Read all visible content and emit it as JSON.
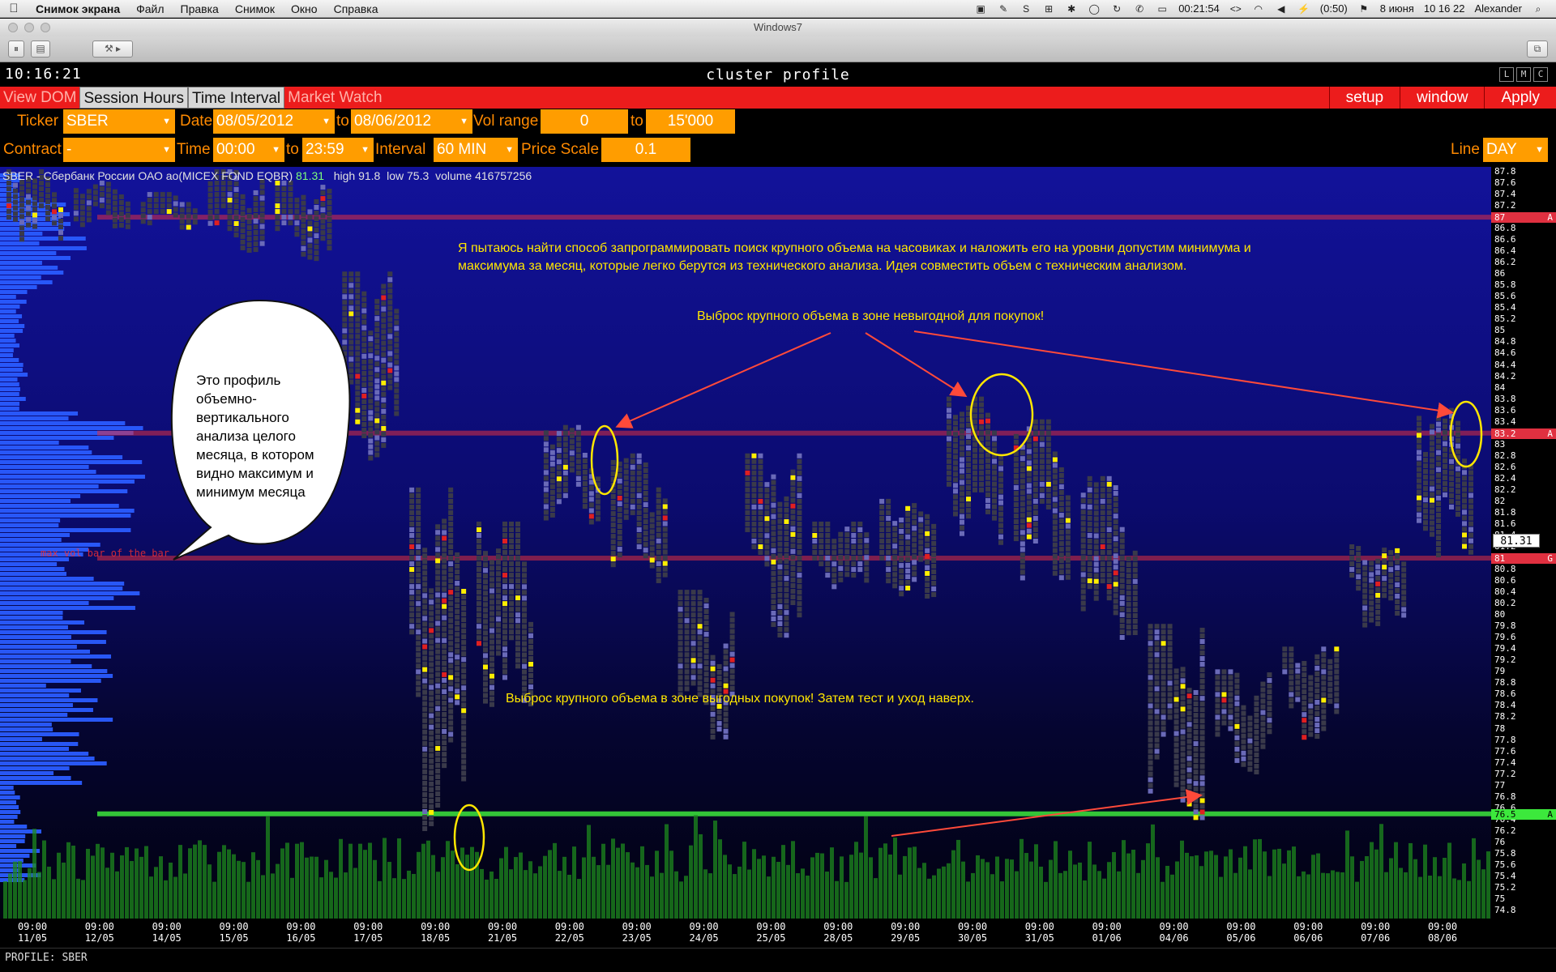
{
  "menubar": {
    "app_name": "Снимок экрана",
    "items": [
      "Файл",
      "Правка",
      "Снимок",
      "Окно",
      "Справка"
    ],
    "battery": "00:21:54",
    "battery_time": "(0:50)",
    "date": "8 июня",
    "time": "10 16 22",
    "user": "Alexander"
  },
  "window": {
    "title": "Windows7"
  },
  "app": {
    "clock": "10:16:21",
    "title": "cluster profile",
    "window_buttons": [
      "L",
      "M",
      "C"
    ]
  },
  "tabs": {
    "items": [
      "View DOM",
      "Session Hours",
      "Time Interval",
      "Market Watch"
    ],
    "right_buttons": [
      "setup",
      "window",
      "Apply"
    ]
  },
  "controls": {
    "ticker_label": "Ticker",
    "ticker_value": "SBER",
    "date_label": "Date",
    "date_from": "08/05/2012",
    "date_to_label": "to",
    "date_to": "08/06/2012",
    "vol_range_label": "Vol range",
    "vol_from": "0",
    "vol_to_label": "to",
    "vol_to": "15'000",
    "contract_label": "Contract",
    "contract_value": "-",
    "time_label": "Time",
    "time_from": "00:00",
    "time_to_label": "to",
    "time_to": "23:59",
    "interval_label": "Interval",
    "interval_value": "60 MIN",
    "price_scale_label": "Price Scale",
    "price_scale_value": "0.1",
    "line_label": "Line",
    "line_value": "DAY"
  },
  "chart_header": {
    "symbol": "SBER",
    "description": " - Сбербанк России ОАО ао(MICEX FOND EQBR) ",
    "last": "81.31",
    "high": "high 91.8",
    "low": "low 75.3",
    "volume": "volume 416757256"
  },
  "annotations": {
    "top_text_line1": "Я пытаюсь найти способ запрограммировать поиск крупного объема на часовиках и наложить его на уровни допустим минимума и",
    "top_text_line2": "максимума за месяц, которые легко берутся из технического анализа. Идея совместить объем с техническим анализом.",
    "unfavorable": "Выброс крупного объема в зоне невыгодной для покупок!",
    "favorable": "Выброс крупного объема в зоне выгодных покупок! Затем тест и уход наверх.",
    "bubble": "Это профиль объемно-вертикального анализа целого месяца, в котором видно максимум и минимум месяца",
    "max_vol_bar": "max vol bar of the bar"
  },
  "colors": {
    "accent_red": "#ec1c1c",
    "field_orange": "#ff9d00",
    "label_orange": "#ff8a00",
    "level_red": "#e03040",
    "level_green": "#3ce83c",
    "annotation_yellow": "#ffe600",
    "profile_blue": "#2a5cff"
  },
  "chart_data": {
    "type": "bar",
    "title": "cluster profile",
    "symbol": "SBER",
    "interval": "60 MIN",
    "price_range": [
      74.8,
      87.8
    ],
    "price_ticks": [
      "87.8",
      "87.6",
      "87.4",
      "87.2",
      "87",
      "86.8",
      "86.6",
      "86.4",
      "86.2",
      "86",
      "85.8",
      "85.6",
      "85.4",
      "85.2",
      "85",
      "84.8",
      "84.6",
      "84.4",
      "84.2",
      "84",
      "83.8",
      "83.6",
      "83.4",
      "83.2",
      "83",
      "82.8",
      "82.6",
      "82.4",
      "82.2",
      "82",
      "81.8",
      "81.6",
      "81.4",
      "81.2",
      "81",
      "80.8",
      "80.6",
      "80.4",
      "80.2",
      "80",
      "79.8",
      "79.6",
      "79.4",
      "79.2",
      "79",
      "78.8",
      "78.6",
      "78.4",
      "78.2",
      "78",
      "77.8",
      "77.6",
      "77.4",
      "77.2",
      "77",
      "76.8",
      "76.6",
      "76.4",
      "76.2",
      "76",
      "75.8",
      "75.6",
      "75.4",
      "75.2",
      "75",
      "74.8"
    ],
    "levels": [
      {
        "price": 87.0,
        "label": "87",
        "color": "#e03040",
        "marker": "A"
      },
      {
        "price": 83.2,
        "label": "83.2",
        "color": "#e03040",
        "marker": "A"
      },
      {
        "price": 81.0,
        "label": "81",
        "color": "#e03040",
        "marker": "G"
      },
      {
        "price": 76.5,
        "label": "76.5",
        "color": "#3ce83c",
        "marker": "A"
      }
    ],
    "current_price": "81.31",
    "categories": [
      "11/05",
      "12/05",
      "14/05",
      "15/05",
      "16/05",
      "17/05",
      "18/05",
      "21/05",
      "22/05",
      "23/05",
      "24/05",
      "25/05",
      "28/05",
      "29/05",
      "30/05",
      "31/05",
      "01/06",
      "04/06",
      "05/06",
      "06/06",
      "07/06",
      "08/06"
    ],
    "session_time": "09:00",
    "daily_high": [
      87.8,
      87.6,
      87.4,
      87.8,
      87.6,
      86.0,
      82.2,
      81.6,
      83.3,
      82.8,
      80.4,
      82.8,
      81.6,
      82.0,
      83.8,
      83.4,
      82.4,
      79.8,
      79.0,
      79.4,
      81.2,
      83.6
    ],
    "daily_low": [
      86.6,
      86.8,
      86.8,
      86.4,
      86.2,
      82.4,
      76.2,
      78.4,
      81.6,
      80.6,
      77.8,
      79.6,
      80.4,
      80.0,
      81.2,
      80.6,
      79.6,
      76.4,
      77.2,
      77.8,
      79.8,
      81.0
    ],
    "volume_profile_note": "Monthly volume profile on left axis",
    "max_vol_bar_label": "max vol bar of the bar",
    "ellipses": [
      "22/05 ~82.6-83.3",
      "30/05 ~83.0-83.8",
      "08/06 ~82.8-83.5",
      "18/05 ~76.0-76.7"
    ]
  },
  "status": {
    "text": "PROFILE: SBER"
  }
}
